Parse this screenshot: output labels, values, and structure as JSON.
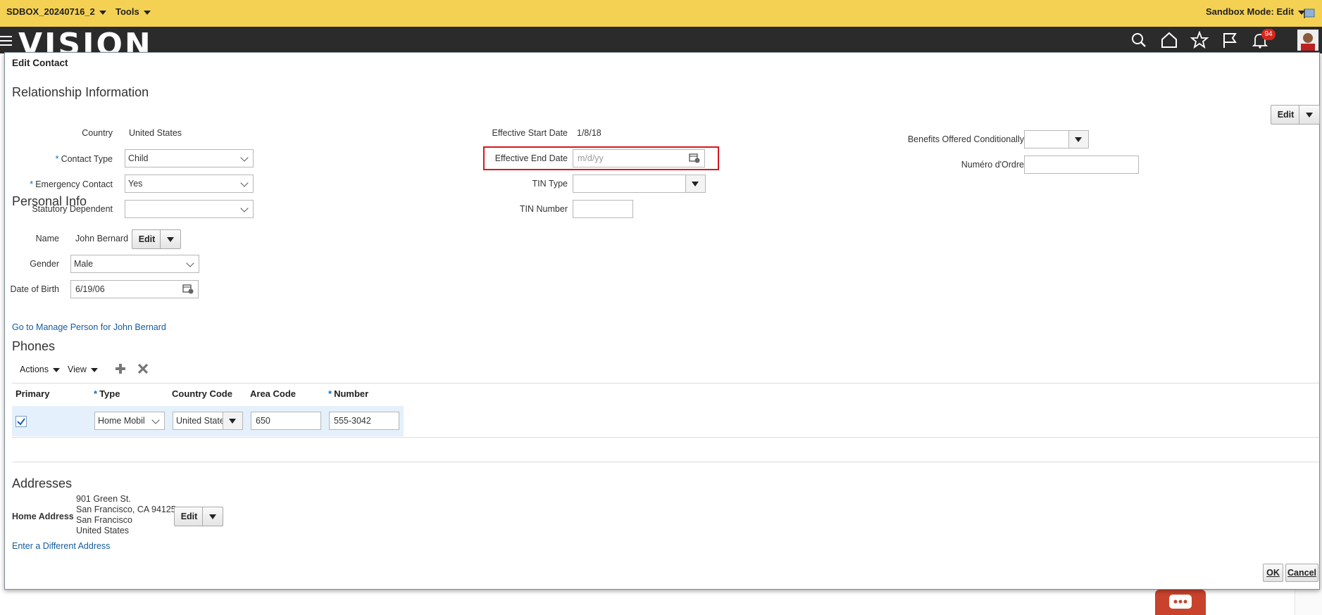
{
  "sandbox_bar": {
    "sandbox_name": "SDBOX_20240716_2",
    "tools_label": "Tools",
    "mode_label": "Sandbox Mode: Edit"
  },
  "header": {
    "logo_text": "VISION",
    "notification_count": "94"
  },
  "dialog": {
    "title": "Edit Contact",
    "relationship": {
      "heading": "Relationship Information",
      "edit_label": "Edit",
      "country_label": "Country",
      "country_value": "United States",
      "contact_type_label": "Contact Type",
      "contact_type_value": "Child",
      "emergency_contact_label": "Emergency Contact",
      "emergency_contact_value": "Yes",
      "statutory_dependent_label": "Statutory Dependent",
      "statutory_dependent_value": "",
      "effective_start_label": "Effective Start Date",
      "effective_start_value": "1/8/18",
      "effective_end_label": "Effective End Date",
      "effective_end_placeholder": "m/d/yy",
      "tin_type_label": "TIN Type",
      "tin_number_label": "TIN Number",
      "benefits_label": "Benefits Offered Conditionally",
      "numero_label": "Numéro d'Ordre"
    },
    "personal": {
      "heading": "Personal Info",
      "name_label": "Name",
      "name_value": "John Bernard",
      "edit_label": "Edit",
      "gender_label": "Gender",
      "gender_value": "Male",
      "dob_label": "Date of Birth",
      "dob_value": "6/19/06",
      "manage_link": "Go to Manage Person for John Bernard"
    },
    "phones": {
      "heading": "Phones",
      "actions_label": "Actions",
      "view_label": "View",
      "columns": {
        "primary": "Primary",
        "type": "Type",
        "country_code": "Country Code",
        "area_code": "Area Code",
        "number": "Number"
      },
      "rows": [
        {
          "type": "Home Mobil",
          "country_code": "United State",
          "area_code": "650",
          "number": "555-3042"
        }
      ]
    },
    "addresses": {
      "heading": "Addresses",
      "home_label": "Home Address",
      "line1": "901 Green St.",
      "line2": "San Francisco, CA 94125",
      "line3": "San Francisco",
      "line4": "United States",
      "edit_label": "Edit",
      "different_link": "Enter a Different Address"
    },
    "ok_label": "OK",
    "cancel_label": "Cancel"
  },
  "colors": {
    "sandbox_bar": "#f5d153",
    "header": "#2b2b2b",
    "highlight": "#d9161f",
    "link": "#145c9e",
    "row_selected": "#e4f0fb"
  }
}
